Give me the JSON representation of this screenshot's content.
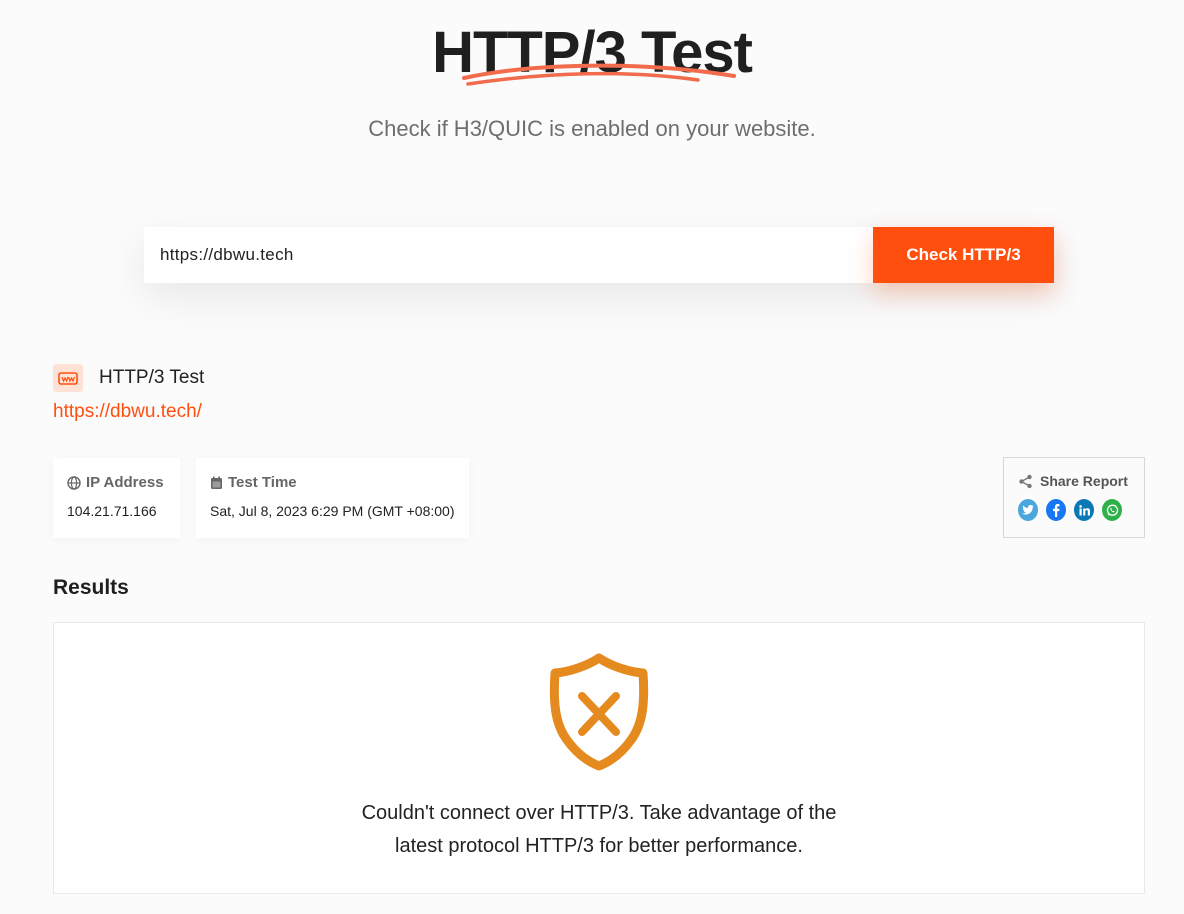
{
  "hero": {
    "title": "HTTP/3 Test",
    "subtitle": "Check if H3/QUIC is enabled on your website."
  },
  "search": {
    "value": "https://dbwu.tech",
    "button_label": "Check HTTP/3"
  },
  "report": {
    "title": "HTTP/3 Test",
    "url": "https://dbwu.tech/",
    "ip_label": "IP Address",
    "ip_value": "104.21.71.166",
    "time_label": "Test Time",
    "time_value": "Sat, Jul 8, 2023 6:29 PM (GMT +08:00)"
  },
  "share": {
    "label": "Share Report",
    "icons": [
      "twitter-icon",
      "facebook-icon",
      "linkedin-icon",
      "whatsapp-icon"
    ]
  },
  "results": {
    "heading": "Results",
    "message_line1": "Couldn't connect over HTTP/3. Take advantage of the",
    "message_line2": "latest protocol HTTP/3 for better performance.",
    "status_icon": "shield-x-icon"
  },
  "colors": {
    "accent": "#ff4f0f",
    "warning": "#e58a1f",
    "twitter": "#4aa6dc",
    "facebook": "#1877f2",
    "linkedin": "#0a78b5",
    "whatsapp": "#2fb14a"
  }
}
